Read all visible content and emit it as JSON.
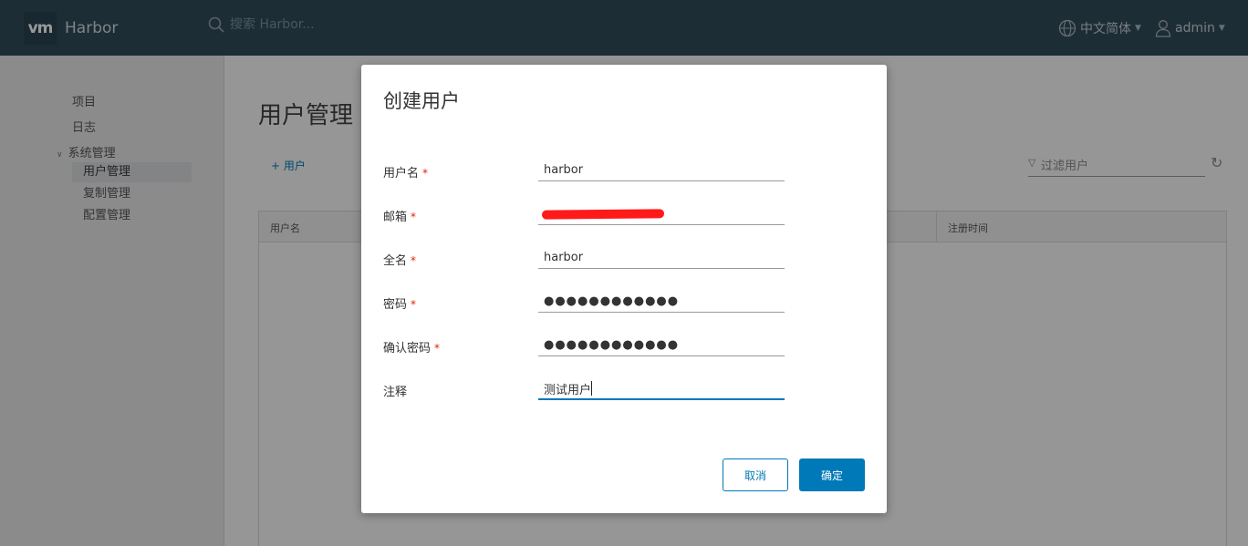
{
  "header": {
    "brand_logo": "vm",
    "brand_name": "Harbor",
    "search_placeholder": "搜索 Harbor...",
    "language": "中文简体",
    "user": "admin",
    "icons": [
      "search-icon",
      "globe-icon",
      "user-icon"
    ]
  },
  "sidebar": {
    "items": [
      {
        "label": "项目"
      },
      {
        "label": "日志"
      },
      {
        "label": "系统管理"
      }
    ],
    "sub_items": [
      {
        "label": "用户管理",
        "active": true
      },
      {
        "label": "复制管理"
      },
      {
        "label": "配置管理"
      }
    ]
  },
  "main": {
    "title": "用户管理",
    "add_user": "+ 用户",
    "filter_placeholder": "过滤用户",
    "columns": [
      "用户名",
      "注册时间"
    ]
  },
  "modal": {
    "title": "创建用户",
    "fields": [
      {
        "label": "用户名",
        "required": true,
        "value": "harbor"
      },
      {
        "label": "邮箱",
        "required": true,
        "value": ""
      },
      {
        "label": "全名",
        "required": true,
        "value": "harbor"
      },
      {
        "label": "密码",
        "required": true,
        "value": "●●●●●●●●●●●●"
      },
      {
        "label": "确认密码",
        "required": true,
        "value": "●●●●●●●●●●●●"
      },
      {
        "label": "注释",
        "required": false,
        "value": "测试用户"
      }
    ],
    "required_mark": "*",
    "cancel_label": "取消",
    "ok_label": "确定"
  },
  "colors": {
    "header_bg": "#314b5b",
    "primary": "#0079b8",
    "required": "#e12200"
  }
}
